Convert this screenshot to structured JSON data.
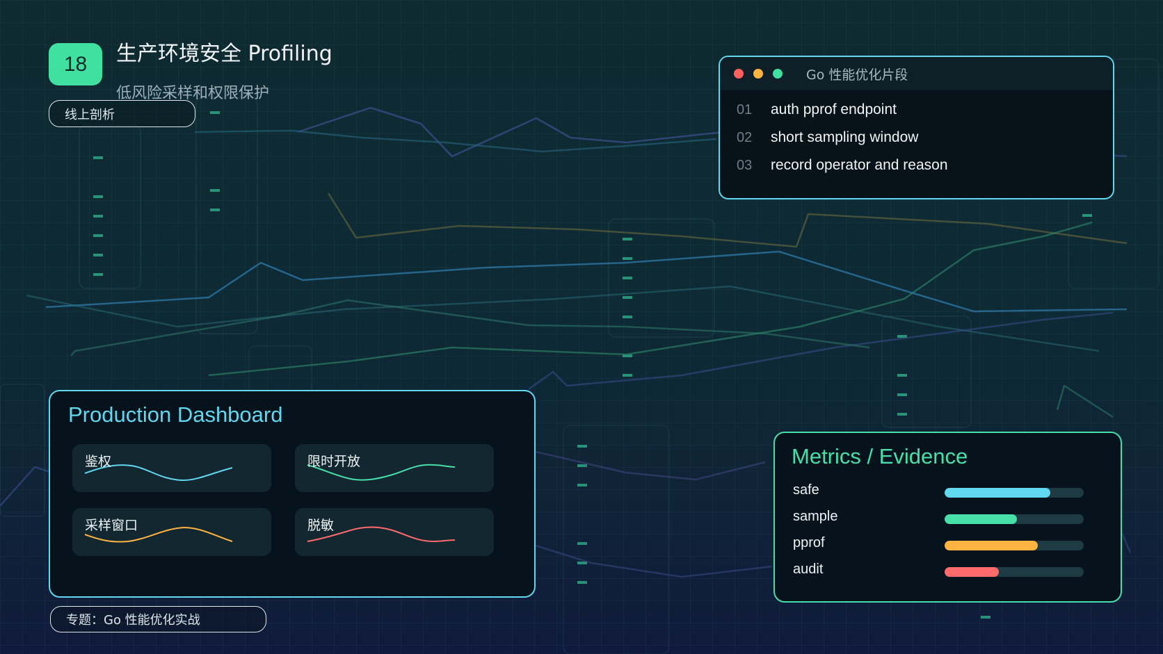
{
  "slide": {
    "number": "18",
    "title": "生产环境安全 Profiling",
    "subtitle": "低风险采样和权限保护",
    "tag": "线上剖析",
    "footer": "专题：Go 性能优化实战"
  },
  "code_card": {
    "title": "Go 性能优化片段",
    "window_dots": [
      "#ff5f5f",
      "#ffb340",
      "#3fe0a0"
    ],
    "lines": [
      {
        "num": "01",
        "text": "auth pprof endpoint"
      },
      {
        "num": "02",
        "text": "short sampling window"
      },
      {
        "num": "03",
        "text": "record operator and reason"
      }
    ]
  },
  "dashboard": {
    "title": "Production Dashboard",
    "tiles": [
      {
        "label": "鉴权",
        "color": "#5fd8f0"
      },
      {
        "label": "限时开放",
        "color": "#46e0a8"
      },
      {
        "label": "采样窗口",
        "color": "#ffb340"
      },
      {
        "label": "脱敏",
        "color": "#ff6b6b"
      }
    ]
  },
  "metrics": {
    "title": "Metrics / Evidence",
    "items": [
      {
        "label": "safe",
        "value": 0.76,
        "color": "#5fd8f0"
      },
      {
        "label": "sample",
        "value": 0.52,
        "color": "#46e0a8"
      },
      {
        "label": "pprof",
        "value": 0.67,
        "color": "#ffb340"
      },
      {
        "label": "audit",
        "value": 0.39,
        "color": "#ff6b6b"
      }
    ]
  }
}
